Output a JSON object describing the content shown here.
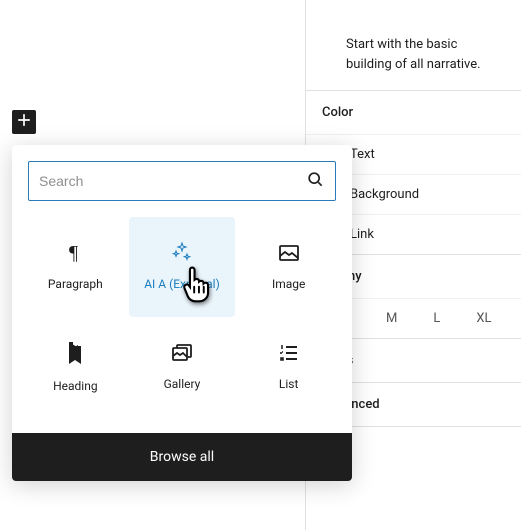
{
  "settings": {
    "intro": "Start with the basic building of all narrative.",
    "color": {
      "heading": "Color",
      "text": "Text",
      "background": "Background",
      "link": "Link"
    },
    "typography": {
      "heading": "graphy",
      "sizes": [
        "M",
        "L",
        "XL"
      ]
    },
    "dimensions": {
      "heading": "sions"
    },
    "advanced": {
      "heading": "Advanced"
    }
  },
  "inserter": {
    "search_placeholder": "Search",
    "blocks": [
      {
        "label": "Paragraph"
      },
      {
        "label": "AI A (Exper al)"
      },
      {
        "label": "Image"
      },
      {
        "label": "Heading"
      },
      {
        "label": "Gallery"
      },
      {
        "label": "List"
      }
    ],
    "browse_all": "Browse all"
  }
}
